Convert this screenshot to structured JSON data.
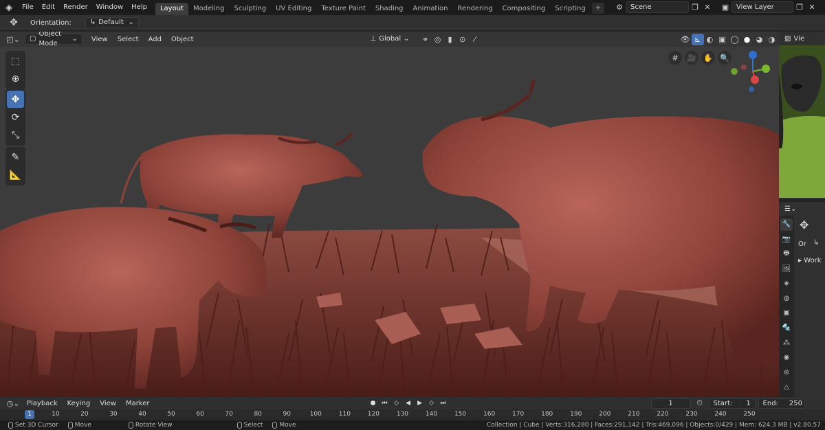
{
  "topbar": {
    "menus": [
      "File",
      "Edit",
      "Render",
      "Window",
      "Help"
    ],
    "workspaces": [
      "Layout",
      "Modeling",
      "Sculpting",
      "UV Editing",
      "Texture Paint",
      "Shading",
      "Animation",
      "Rendering",
      "Compositing",
      "Scripting"
    ],
    "active_workspace": "Layout",
    "add_tab": "+",
    "scene_value": "Scene",
    "view_layer_value": "View Layer"
  },
  "tool_header": {
    "orientation_label": "Orientation:",
    "orientation_value": "Default"
  },
  "viewport_header": {
    "mode": "Object Mode",
    "menus": [
      "View",
      "Select",
      "Add",
      "Object"
    ],
    "transform_orientation": "Global"
  },
  "right_pane": {
    "image_editor_label": "Vie",
    "props_label_or": "Or",
    "props_label_work": "Work"
  },
  "timeline": {
    "menus": [
      "Playback",
      "Keying",
      "View",
      "Marker"
    ],
    "current_frame": "1",
    "start_label": "Start:",
    "start_value": "1",
    "end_label": "End:",
    "end_value": "250",
    "ruler_ticks": [
      "1",
      "10",
      "20",
      "30",
      "40",
      "50",
      "60",
      "70",
      "80",
      "90",
      "100",
      "110",
      "120",
      "130",
      "140",
      "150",
      "160",
      "170",
      "180",
      "190",
      "200",
      "210",
      "220",
      "230",
      "240",
      "250"
    ]
  },
  "statusbar": {
    "left_items": [
      "Set 3D Cursor",
      "Move",
      "Rotate View",
      "Select",
      "Move"
    ],
    "stats": "Collection | Cube | Verts:316,280 | Faces:291,142 | Tris:469,096 | Objects:0/429 | Mem: 624.3 MB | v2.80.57"
  },
  "colors": {
    "accent_blue": "#4772b3",
    "header_bg": "#303030",
    "viewport_bg": "#3c3c3c",
    "clay": "#9b4a40"
  },
  "icons": {
    "toolbar": [
      "select-box-icon",
      "cursor-icon",
      "move-icon",
      "rotate-icon",
      "scale-icon",
      "annotate-icon",
      "measure-icon"
    ]
  }
}
